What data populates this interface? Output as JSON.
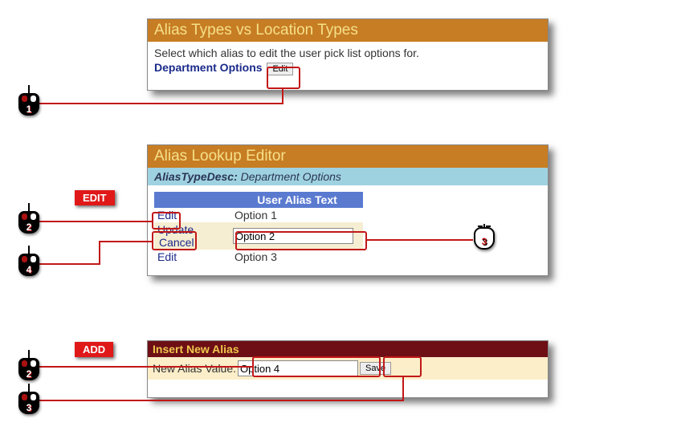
{
  "panel1": {
    "title": "Alias Types vs Location Types",
    "instruction": "Select which alias to edit the user pick list options for.",
    "option_label": "Department Options",
    "edit_btn": "Edit"
  },
  "panel2": {
    "title": "Alias Lookup Editor",
    "type_label": "AliasTypeDesc:",
    "type_value": "Department Options",
    "col_action": "",
    "col_text": "User Alias Text",
    "rows": [
      {
        "action": "Edit",
        "text": "Option 1"
      },
      {
        "action1": "Update",
        "action2": "Cancel",
        "text": "Option 2"
      },
      {
        "action": "Edit",
        "text": "Option 3"
      }
    ]
  },
  "panel3": {
    "title": "Insert New Alias",
    "label": "New Alias Value:",
    "value": "Option 4",
    "save_btn": "Save"
  },
  "labels": {
    "edit": "EDIT",
    "add": "ADD"
  },
  "badges": {
    "b1": "1",
    "b2": "2",
    "b3": "3",
    "b4": "4",
    "b2b": "2",
    "b3b": "3"
  }
}
